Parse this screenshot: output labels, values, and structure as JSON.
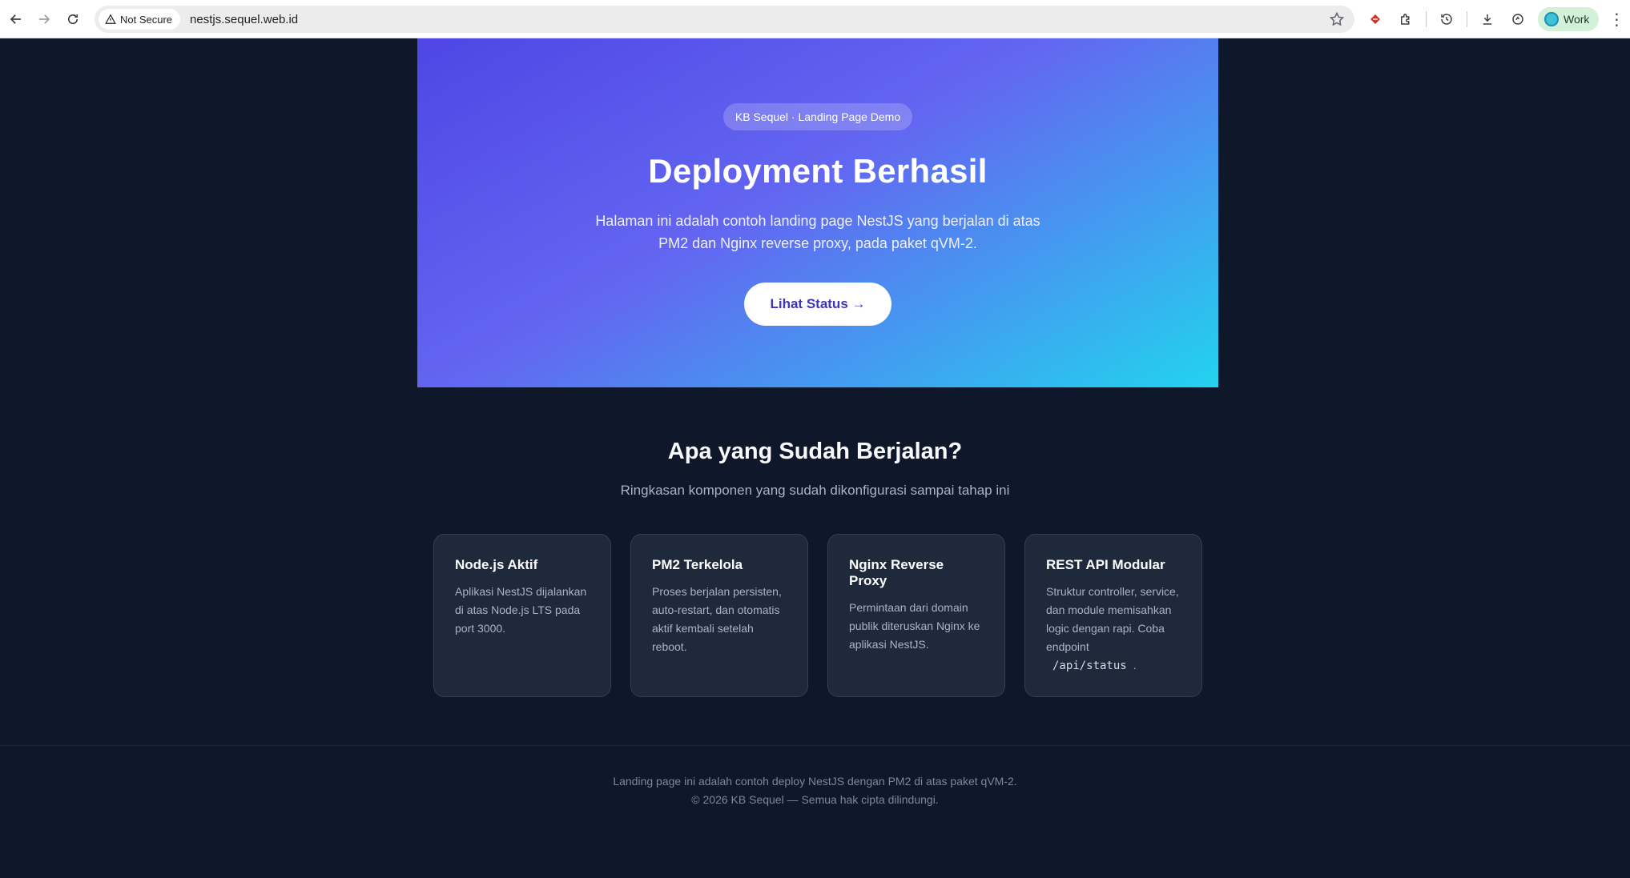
{
  "browser": {
    "security_label": "Not Secure",
    "url": "nestjs.sequel.web.id",
    "profile_label": "Work"
  },
  "hero": {
    "badge": "KB Sequel · Landing Page Demo",
    "title": "Deployment Berhasil",
    "description": "Halaman ini adalah contoh landing page NestJS yang berjalan di atas PM2 dan Nginx reverse proxy, pada paket qVM-2.",
    "button_label": "Lihat Status →"
  },
  "features": {
    "title": "Apa yang Sudah Berjalan?",
    "subtitle": "Ringkasan komponen yang sudah dikonfigurasi sampai tahap ini",
    "cards": [
      {
        "title": "Node.js Aktif",
        "description": "Aplikasi NestJS dijalankan di atas Node.js LTS pada port 3000."
      },
      {
        "title": "PM2 Terkelola",
        "description": "Proses berjalan persisten, auto-restart, dan otomatis aktif kembali setelah reboot."
      },
      {
        "title": "Nginx Reverse Proxy",
        "description": "Permintaan dari domain publik diteruskan Nginx ke aplikasi NestJS."
      },
      {
        "title": "REST API Modular",
        "description": "Struktur controller, service, dan module memisahkan logic dengan rapi. Coba endpoint",
        "code": "/api/status",
        "suffix": "."
      }
    ]
  },
  "footer": {
    "line1": "Landing page ini adalah contoh deploy NestJS dengan PM2 di atas paket qVM-2.",
    "line2": "© 2026 KB Sequel — Semua hak cipta dilindungi."
  }
}
